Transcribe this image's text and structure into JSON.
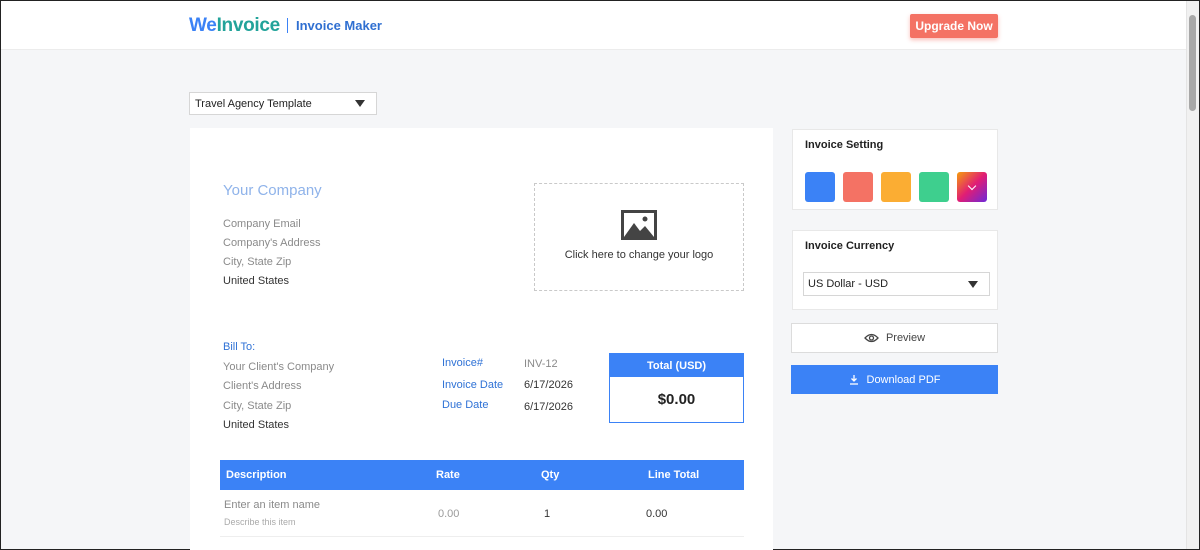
{
  "header": {
    "logo_we": "We",
    "logo_invoice": "Invoice",
    "app_name": "Invoice Maker",
    "upgrade_label": "Upgrade Now"
  },
  "template_select": {
    "value": "Travel Agency Template"
  },
  "company": {
    "name": "Your Company",
    "email": "Company Email",
    "address": "Company's Address",
    "city": "City, State Zip",
    "country": "United States"
  },
  "logo_upload": {
    "hint": "Click here to change your logo"
  },
  "bill_to": {
    "label": "Bill To:",
    "company": "Your Client's Company",
    "address": "Client's Address",
    "city": "City, State Zip",
    "country": "United States"
  },
  "invoice_meta": {
    "number_label": "Invoice#",
    "number_value": "INV-12",
    "date_label": "Invoice Date",
    "date_value": "6/17/2026",
    "due_label": "Due Date",
    "due_value": "6/17/2026"
  },
  "total": {
    "label": "Total (USD)",
    "amount": "$0.00"
  },
  "items_table": {
    "columns": [
      "Description",
      "Rate",
      "Qty",
      "Line Total"
    ],
    "rows": [
      {
        "name": "Enter an item name",
        "description": "Describe this item",
        "rate": "0.00",
        "qty": "1",
        "line_total": "0.00"
      }
    ]
  },
  "settings": {
    "title": "Invoice Setting",
    "colors": [
      "#3b82f6",
      "#f47264",
      "#fbad33",
      "#3ecf8e"
    ]
  },
  "currency": {
    "title": "Invoice Currency",
    "value": "US Dollar - USD"
  },
  "actions": {
    "preview_label": "Preview",
    "download_label": "Download PDF"
  }
}
